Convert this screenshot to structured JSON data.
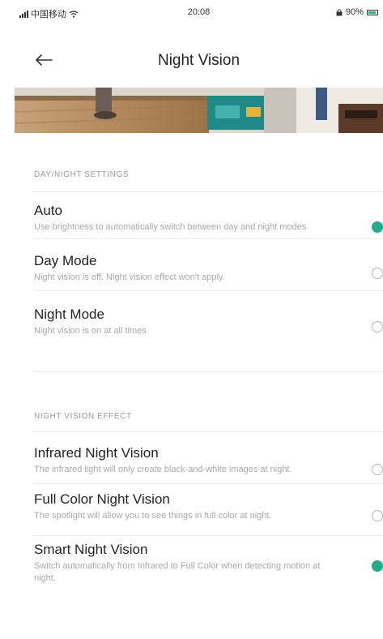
{
  "status_bar": {
    "carrier": "中国移动",
    "time": "20:08",
    "battery": "90%"
  },
  "header": {
    "title": "Night Vision"
  },
  "day_night": {
    "section_title": "DAY/NIGHT SETTINGS",
    "options": [
      {
        "title": "Auto",
        "description": "Use brightness to automatically switch between day and night modes",
        "selected": true
      },
      {
        "title": "Day Mode",
        "description": "Night vision is off. Night vision effect won't apply.",
        "selected": false
      },
      {
        "title": "Night Mode",
        "description": "Night vision is on at all times",
        "selected": false
      }
    ]
  },
  "effect": {
    "section_title": "NIGHT VISION EFFECT",
    "options": [
      {
        "title": "Infrared Night Vision",
        "description": "The infrared light will only create black-and-white images at night.",
        "selected": false
      },
      {
        "title": "Full Color Night Vision",
        "description": "The spotlight will allow you to see things in full color at night.",
        "selected": false
      },
      {
        "title": "Smart Night Vision",
        "description": "Switch automatically from Infrared to Full Color when detecting motion at night.",
        "selected": true
      }
    ]
  },
  "colors": {
    "accent": "#1fae8c",
    "radio_border": "#b5b5b5"
  }
}
